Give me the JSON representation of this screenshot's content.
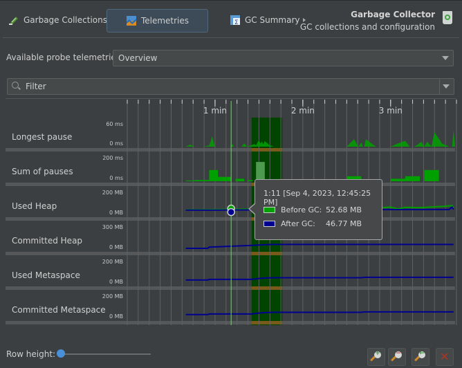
{
  "toolbar": {
    "garbage_collections": "Garbage Collections",
    "telemetries": "Telemetries",
    "gc_summary": "GC Summary",
    "header_title": "Garbage Collector",
    "header_subtitle": "GC collections and configuration"
  },
  "probe": {
    "label": "Available probe telemetries:",
    "selected": "Overview"
  },
  "filter": {
    "placeholder": "Filter"
  },
  "timeline": {
    "time_labels": [
      "1 min",
      "2 min",
      "3 min"
    ],
    "rows": [
      {
        "label": "Longest pause",
        "max": "60 ms",
        "min": "0 ms"
      },
      {
        "label": "Sum of pauses",
        "max": "200 ms",
        "min": "0 ms"
      },
      {
        "label": "Used Heap",
        "max": "200 MB",
        "min": "0 MB"
      },
      {
        "label": "Committed Heap",
        "max": "300 MB",
        "min": "0 MB"
      },
      {
        "label": "Used Metaspace",
        "max": "200 MB",
        "min": "0 MB"
      },
      {
        "label": "Committed Metaspace",
        "max": "200 MB",
        "min": "0 MB"
      }
    ],
    "colors": {
      "before_gc": "#00a000",
      "after_gc": "#000090",
      "selection": "#004400",
      "selection_bar": "#7a5a1a",
      "cursor": "#7fc97f"
    }
  },
  "tooltip": {
    "time": "1:11 [Sep 4, 2023, 12:45:25 PM]",
    "before_label": "Before GC:",
    "before_value": "52.68 MB",
    "after_label": "After GC:",
    "after_value": "46.77 MB"
  },
  "footer": {
    "row_height_label": "Row height:",
    "row_height_value": 0
  },
  "chart_data": {
    "type": "line",
    "x_unit": "seconds",
    "xlim": [
      0,
      225
    ],
    "x_ticks": [
      {
        "value": 60,
        "label": "1 min"
      },
      {
        "value": 120,
        "label": "2 min"
      },
      {
        "value": 180,
        "label": "3 min"
      }
    ],
    "cursor_x": 71,
    "selection_range": [
      85,
      106
    ],
    "series": [
      {
        "name": "Longest pause",
        "unit": "ms",
        "ylim": [
          0,
          60
        ],
        "x": [
          40,
          43,
          46,
          52,
          56,
          57,
          58,
          59,
          60,
          64,
          70,
          72,
          73,
          74,
          78,
          80,
          82,
          85,
          87,
          88,
          89,
          90,
          91,
          92,
          93,
          94,
          95,
          96,
          97,
          100,
          150,
          155,
          158,
          160,
          161,
          162,
          163,
          170,
          175,
          180,
          185,
          190,
          193,
          196,
          199,
          201,
          203,
          205,
          208,
          209,
          210,
          215,
          220,
          222,
          223,
          224
        ],
        "values": [
          0,
          5,
          0,
          0,
          3,
          12,
          25,
          12,
          0,
          0,
          0,
          6,
          0,
          0,
          0,
          8,
          0,
          4,
          6,
          3,
          10,
          15,
          8,
          12,
          6,
          14,
          10,
          8,
          4,
          0,
          0,
          18,
          0,
          10,
          0,
          0,
          18,
          0,
          0,
          0,
          8,
          14,
          0,
          0,
          6,
          12,
          0,
          12,
          0,
          20,
          35,
          8,
          0,
          0,
          40,
          5
        ]
      },
      {
        "name": "Sum of pauses",
        "unit": "ms",
        "type": "bar",
        "ylim": [
          0,
          200
        ],
        "bars": [
          {
            "x0": 40,
            "x1": 46,
            "v": 6
          },
          {
            "x0": 46,
            "x1": 56,
            "v": 10
          },
          {
            "x0": 56,
            "x1": 62,
            "v": 90
          },
          {
            "x0": 62,
            "x1": 68,
            "v": 35
          },
          {
            "x0": 68,
            "x1": 71,
            "v": 35
          },
          {
            "x0": 74,
            "x1": 80,
            "v": 20
          },
          {
            "x0": 82,
            "x1": 86,
            "v": 8
          },
          {
            "x0": 88,
            "x1": 94,
            "v": 155
          },
          {
            "x0": 150,
            "x1": 160,
            "v": 40
          },
          {
            "x0": 180,
            "x1": 190,
            "v": 20
          },
          {
            "x0": 190,
            "x1": 200,
            "v": 40
          },
          {
            "x0": 203,
            "x1": 213,
            "v": 90
          }
        ]
      },
      {
        "name": "Used Heap - Before GC",
        "unit": "MB",
        "ylim": [
          0,
          200
        ],
        "x": [
          40,
          60,
          71,
          80,
          90,
          100,
          110,
          130,
          150,
          170,
          180,
          185,
          190,
          200,
          210,
          215,
          220,
          222,
          223
        ],
        "values": [
          48,
          50,
          52,
          53,
          52,
          54,
          56,
          58,
          60,
          62,
          70,
          55,
          68,
          65,
          72,
          75,
          80,
          82,
          60
        ]
      },
      {
        "name": "Used Heap - After GC",
        "unit": "MB",
        "ylim": [
          0,
          200
        ],
        "x": [
          40,
          60,
          71,
          80,
          90,
          100,
          150,
          200,
          220,
          222,
          223
        ],
        "values": [
          46,
          46,
          47,
          47,
          48,
          48,
          50,
          50,
          51,
          70,
          51
        ]
      },
      {
        "name": "Committed Heap",
        "unit": "MB",
        "ylim": [
          0,
          300
        ],
        "x": [
          40,
          55,
          56,
          85,
          95,
          100,
          223
        ],
        "values": [
          25,
          25,
          40,
          60,
          70,
          72,
          72
        ]
      },
      {
        "name": "Used Metaspace",
        "unit": "MB",
        "ylim": [
          0,
          200
        ],
        "x": [
          40,
          55,
          56,
          85,
          92,
          100,
          160,
          162,
          223
        ],
        "values": [
          40,
          40,
          45,
          45,
          55,
          58,
          58,
          62,
          62
        ]
      },
      {
        "name": "Committed Metaspace",
        "unit": "MB",
        "ylim": [
          0,
          200
        ],
        "x": [
          40,
          55,
          56,
          85,
          92,
          100,
          160,
          162,
          223
        ],
        "values": [
          40,
          40,
          45,
          45,
          55,
          58,
          58,
          62,
          62
        ]
      }
    ]
  }
}
